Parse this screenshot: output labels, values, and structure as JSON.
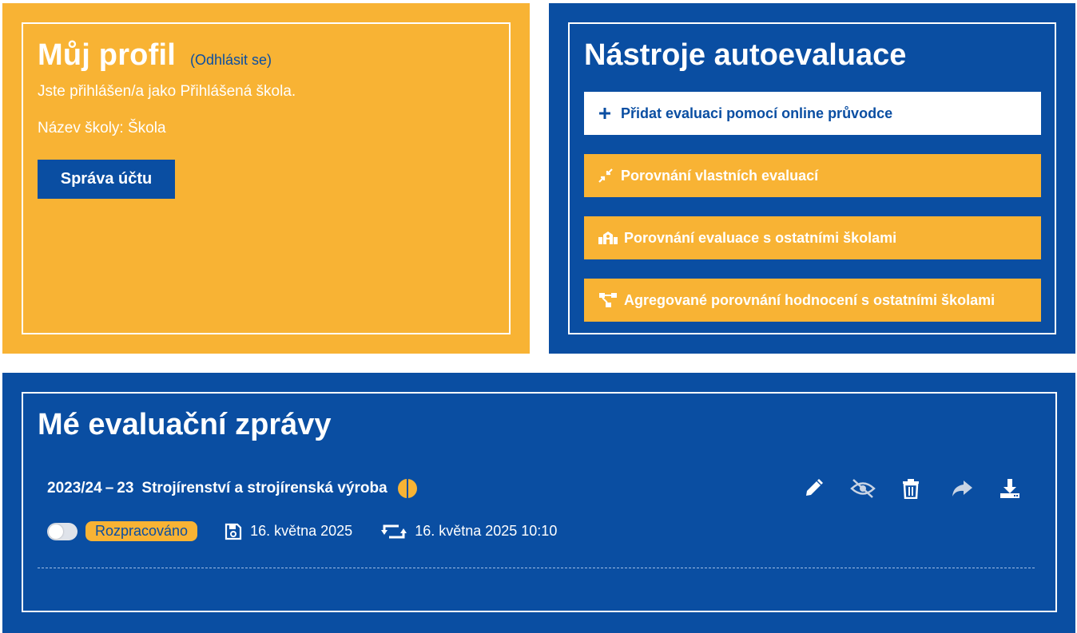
{
  "profile": {
    "title": "Můj profil",
    "logout_label": "(Odhlásit se)",
    "logged_as": "Jste přihlášen/a jako Přihlášená škola.",
    "school_name": "Název školy: Škola",
    "account_button": "Správa účtu",
    "bg_color": "#f8b334"
  },
  "tools": {
    "title": "Nástroje autoevaluace",
    "bg_color": "#0a4ea2",
    "items": [
      {
        "label": "Přidat evaluaci pomocí online průvodce",
        "icon": "plus-icon",
        "style": "white"
      },
      {
        "label": "Porovnání vlastních evaluací",
        "icon": "compress-arrows-icon",
        "style": "yellow"
      },
      {
        "label": "Porovnání evaluace s ostatními školami",
        "icon": "school-icon",
        "style": "yellow"
      },
      {
        "label": "Agregované porovnání hodnocení s ostatními školami",
        "icon": "network-icon",
        "style": "yellow"
      }
    ]
  },
  "reports": {
    "title": "Mé evaluační zprávy",
    "items": [
      {
        "year": "2023/24",
        "separator": "–",
        "code": "23",
        "name": "Strojírenství a strojírenská výroba",
        "progress_icon": "half-circle-icon",
        "status": "Rozpracováno",
        "saved_date": "16. května 2025",
        "updated_datetime": "16. května 2025 10:10",
        "actions": [
          "pencil-icon",
          "eye-slash-icon",
          "trash-icon",
          "share-icon",
          "download-icon"
        ]
      }
    ]
  }
}
